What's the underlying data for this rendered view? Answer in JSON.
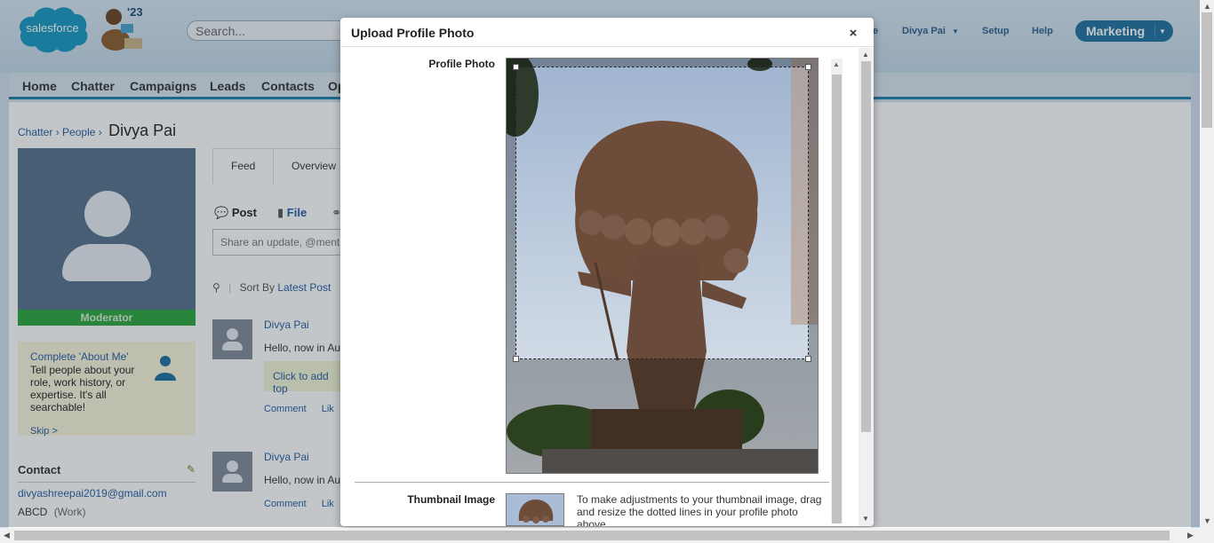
{
  "header": {
    "logo_text": "salesforce",
    "mascot_year": "'23",
    "search_placeholder": "Search...",
    "user_menu": "Divya Pai",
    "setup": "Setup",
    "help": "Help",
    "app_name": "Marketing",
    "partial_link": "e"
  },
  "tabs": [
    "Home",
    "Chatter",
    "Campaigns",
    "Leads",
    "Contacts",
    "Op"
  ],
  "breadcrumb": {
    "chatter": "Chatter",
    "people": "People",
    "current": "Divya Pai",
    "sep": "›"
  },
  "profile": {
    "badge": "Moderator",
    "about": {
      "title": "Complete 'About Me'",
      "desc": "Tell people about your role, work history, or expertise. It's all searchable!",
      "skip": "Skip >"
    },
    "contact_heading": "Contact",
    "email": "divyashreepai2019@gmail.com",
    "company": "ABCD",
    "company_type": "(Work)"
  },
  "feed": {
    "tabs": {
      "feed": "Feed",
      "overview": "Overview"
    },
    "publisher": {
      "post": "Post",
      "file": "File"
    },
    "share_placeholder": "Share an update, @menti",
    "sort_label": "Sort By",
    "sort_value": "Latest Post",
    "posts": [
      {
        "author": "Divya Pai",
        "text": "Hello, now in Au",
        "topic": "Click to add top",
        "comment": "Comment",
        "like": "Lik"
      },
      {
        "author": "Divya Pai",
        "text": "Hello, now in Au",
        "comment": "Comment",
        "like": "Lik"
      }
    ]
  },
  "modal": {
    "title": "Upload Profile Photo",
    "close": "×",
    "profile_photo_label": "Profile Photo",
    "thumbnail_label": "Thumbnail Image",
    "thumbnail_hint": "To make adjustments to your thumbnail image, drag and resize the dotted lines in your profile photo above."
  },
  "colors": {
    "brand_blue": "#1f6fa0",
    "moderator_green": "#2ca63c",
    "link_blue": "#215ca0",
    "tab_accent": "#1b7ea8"
  }
}
